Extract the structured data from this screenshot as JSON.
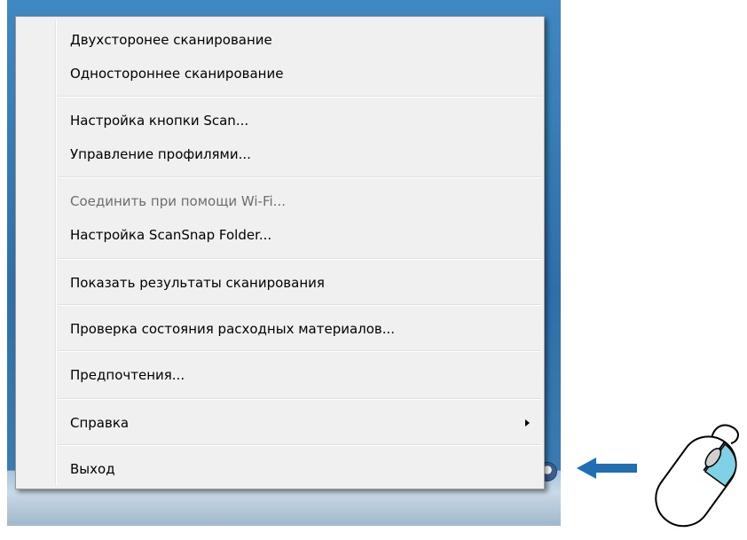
{
  "menu": {
    "items": [
      {
        "label": "Двухсторонее сканирование",
        "disabled": false
      },
      {
        "label": "Одностороннее сканирование",
        "disabled": false
      },
      {
        "label": "Настройка кнопки Scan...",
        "disabled": false
      },
      {
        "label": "Управление профилями...",
        "disabled": false
      },
      {
        "label": "Соединить при помощи Wi-Fi...",
        "disabled": true
      },
      {
        "label": "Настройка ScanSnap Folder...",
        "disabled": false
      },
      {
        "label": "Показать результаты сканирования",
        "disabled": false
      },
      {
        "label": "Проверка состояния расходных материалов...",
        "disabled": false
      },
      {
        "label": "Предпочтения...",
        "disabled": false
      },
      {
        "label": "Справка",
        "disabled": false,
        "has_submenu": true
      },
      {
        "label": "Выход",
        "disabled": false
      }
    ]
  },
  "tray": {
    "icon": "scansnap-manager-icon"
  },
  "annotation": {
    "arrow_color": "#1f6fb5",
    "mouse_highlight_color": "#7fd1e6",
    "mouse_button": "right"
  }
}
